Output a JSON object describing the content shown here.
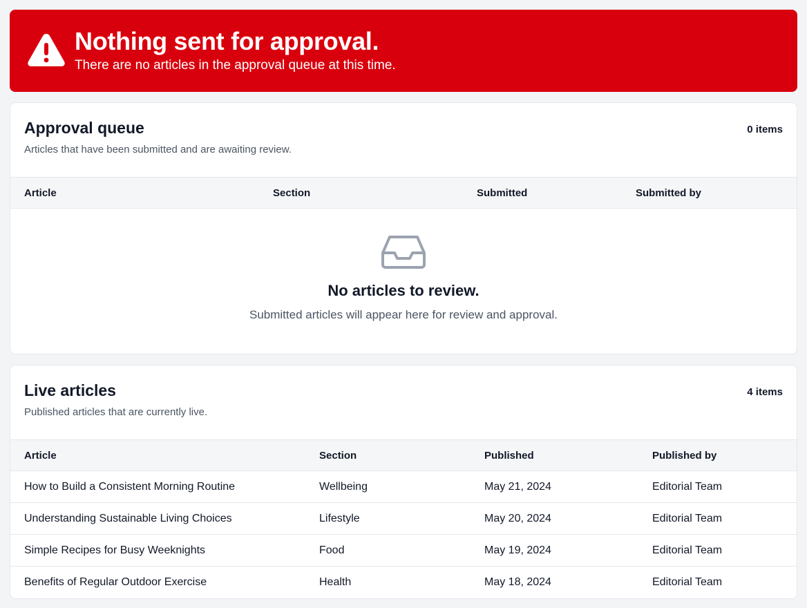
{
  "alert": {
    "icon": "warning-triangle-icon",
    "title": "Nothing sent for approval.",
    "subtitle": "There are no articles in the approval queue at this time.",
    "background_color": "#d9000d"
  },
  "approval_queue": {
    "title": "Approval queue",
    "description": "Articles that have been submitted and are awaiting review.",
    "count": "0 items",
    "columns": [
      "Article",
      "Section",
      "Submitted",
      "Submitted by"
    ],
    "empty_state": {
      "icon": "inbox-icon",
      "title": "No articles to review.",
      "subtitle": "Submitted articles will appear here for review and approval."
    }
  },
  "live_articles": {
    "title": "Live articles",
    "description": "Published articles that are currently live.",
    "count": "4 items",
    "columns": [
      "Article",
      "Section",
      "Published",
      "Published by"
    ],
    "rows": [
      [
        "How to Build a Consistent Morning Routine",
        "Wellbeing",
        "May 21, 2024",
        "Editorial Team"
      ],
      [
        "Understanding Sustainable Living Choices",
        "Lifestyle",
        "May 20, 2024",
        "Editorial Team"
      ],
      [
        "Simple Recipes for Busy Weeknights",
        "Food",
        "May 19, 2024",
        "Editorial Team"
      ],
      [
        "Benefits of Regular Outdoor Exercise",
        "Health",
        "May 18, 2024",
        "Editorial Team"
      ]
    ]
  }
}
